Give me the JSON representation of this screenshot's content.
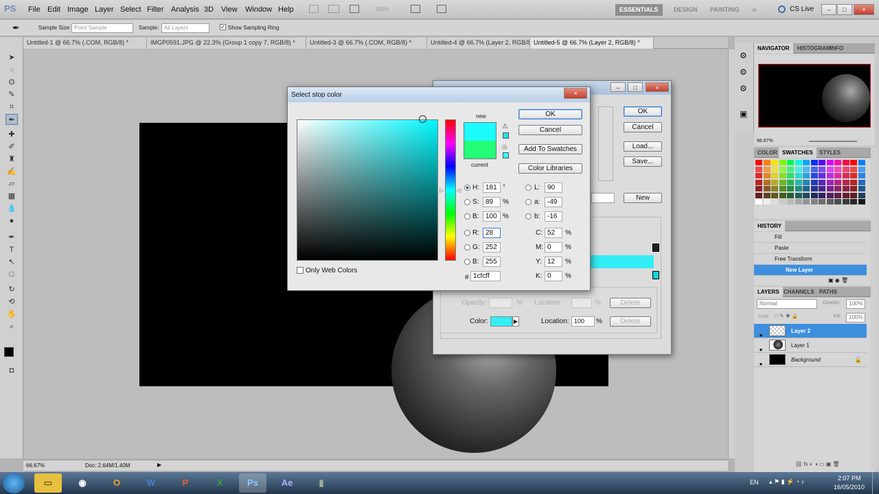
{
  "app": {
    "logo": "PS",
    "menu": [
      "File",
      "Edit",
      "Image",
      "Layer",
      "Select",
      "Filter",
      "Analysis",
      "3D",
      "View",
      "Window",
      "Help"
    ],
    "zoom_field": "100%",
    "workspaces": [
      "ESSENTIALS",
      "DESIGN",
      "PAINTING"
    ],
    "more_workspaces": "»",
    "cs_live": "CS Live"
  },
  "options_bar": {
    "sample_size_label": "Sample Size:",
    "sample_size_value": "Point Sample",
    "sample_label": "Sample:",
    "sample_value": "All Layers",
    "show_ring_label": "Show Sampling Ring"
  },
  "tabs": [
    {
      "label": "Untitled-1 @ 66.7% (.COM, RGB/8) *"
    },
    {
      "label": "IMGP0591.JPG @ 22.3% (Group 1 copy 7, RGB/8) *"
    },
    {
      "label": "Untitled-3 @ 66.7% (.COM, RGB/8) *"
    },
    {
      "label": "Untitled-4 @ 66.7% (Layer 2, RGB/8) *"
    },
    {
      "label": "Untitled-5 @ 66.7% (Layer 2, RGB/8) *"
    }
  ],
  "status": {
    "zoom": "66.67%",
    "doc": "Doc: 2.64M/1.40M"
  },
  "navigator": {
    "tabs": [
      "NAVIGATOR",
      "HISTOGRAM",
      "INFO"
    ],
    "zoom": "66.67%"
  },
  "swatches_panel": {
    "tabs": [
      "COLOR",
      "SWATCHES",
      "STYLES"
    ]
  },
  "history": {
    "title": "HISTORY",
    "items": [
      {
        "label": "Fill"
      },
      {
        "label": "Paste"
      },
      {
        "label": "Free Transform"
      },
      {
        "label": "New Layer"
      }
    ]
  },
  "layers": {
    "tabs": [
      "LAYERS",
      "CHANNELS",
      "PATHS"
    ],
    "blend_mode": "Normal",
    "opacity_label": "Opacity:",
    "opacity": "100%",
    "lock_label": "Lock:",
    "fill_label": "Fill:",
    "fill": "100%",
    "items": [
      {
        "name": "Layer 2"
      },
      {
        "name": "Layer 1"
      },
      {
        "name": "Background"
      }
    ]
  },
  "gradient_editor": {
    "ok": "OK",
    "cancel": "Cancel",
    "load": "Load...",
    "save": "Save...",
    "new": "New",
    "opacity_label": "Opacity:",
    "location_label": "Location:",
    "delete": "Delete",
    "color_label": "Color:",
    "color_location": "100",
    "percent": "%",
    "stop_color": "#33eef5"
  },
  "color_picker": {
    "title": "Select stop color",
    "ok": "OK",
    "cancel": "Cancel",
    "add_to_swatches": "Add To Swatches",
    "color_libraries": "Color Libraries",
    "new_label": "new",
    "current_label": "current",
    "new_color": "#1cfcff",
    "current_color": "#22ff77",
    "only_web_colors": "Only Web Colors",
    "fields": {
      "H": {
        "label": "H:",
        "value": "181",
        "unit": "°"
      },
      "S": {
        "label": "S:",
        "value": "89",
        "unit": "%"
      },
      "B": {
        "label": "B:",
        "value": "100",
        "unit": "%"
      },
      "R": {
        "label": "R:",
        "value": "28"
      },
      "G": {
        "label": "G:",
        "value": "252"
      },
      "Bb": {
        "label": "B:",
        "value": "255"
      },
      "L": {
        "label": "L:",
        "value": "90"
      },
      "a": {
        "label": "a:",
        "value": "-49"
      },
      "b": {
        "label": "b:",
        "value": "-16"
      },
      "C": {
        "label": "C:",
        "value": "52",
        "unit": "%"
      },
      "M": {
        "label": "M:",
        "value": "0",
        "unit": "%"
      },
      "Y": {
        "label": "Y:",
        "value": "12",
        "unit": "%"
      },
      "K": {
        "label": "K:",
        "value": "0",
        "unit": "%"
      }
    },
    "hash": "#",
    "hex": "1cfcff"
  },
  "taskbar": {
    "lang": "EN",
    "time": "2:07 PM",
    "date": "16/05/2010"
  }
}
